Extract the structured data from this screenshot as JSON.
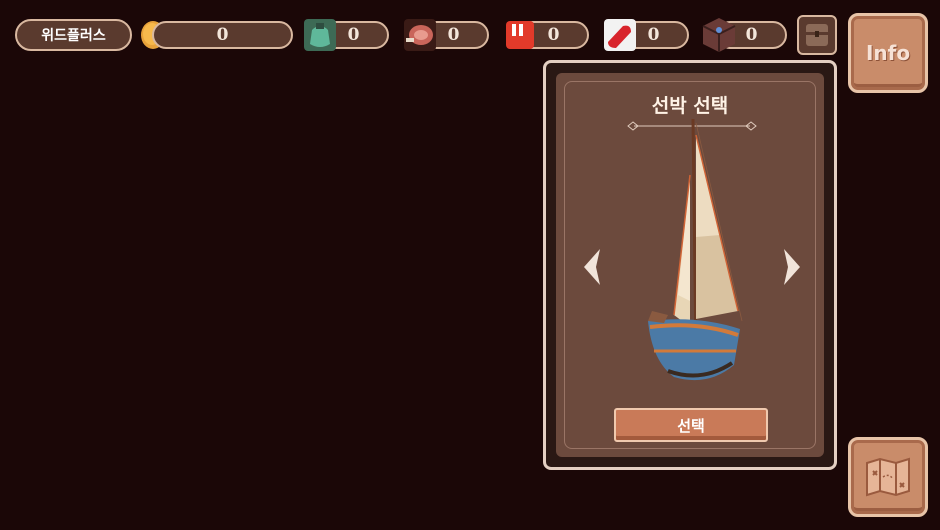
{
  "brand": "위드플러스",
  "resources": [
    {
      "icon": "coin-icon",
      "value": "0"
    },
    {
      "icon": "green-potion-icon",
      "value": "0"
    },
    {
      "icon": "meat-icon",
      "value": "0"
    },
    {
      "icon": "red-box-icon",
      "value": "0"
    },
    {
      "icon": "red-pill-icon",
      "value": "0"
    },
    {
      "icon": "treasure-chest-icon",
      "value": "0"
    }
  ],
  "info_label": "Info",
  "ship_panel": {
    "title": "선박 선택",
    "select_label": "선택"
  }
}
